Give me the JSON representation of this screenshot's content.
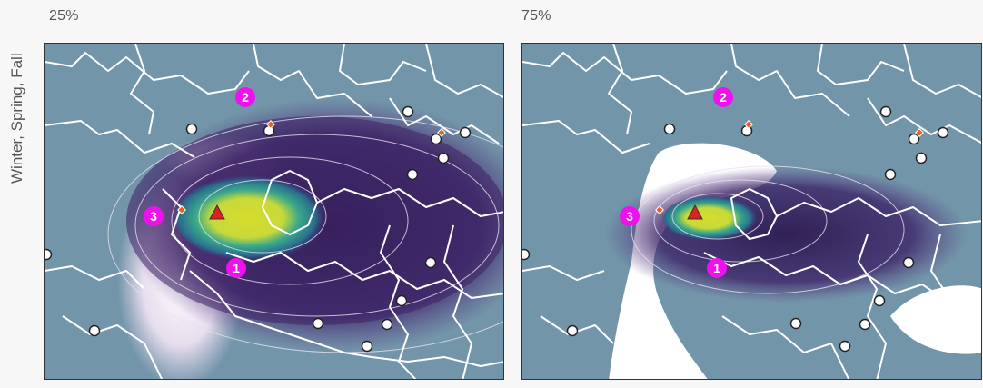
{
  "panels": [
    {
      "title": "25%"
    },
    {
      "title": "75%"
    }
  ],
  "row_label": "Winter, Spring, Fall",
  "markers": {
    "one": "1",
    "two": "2",
    "three": "3"
  },
  "colors": {
    "sea": "#7295a9",
    "border": "#ffffff",
    "plume_dark": "#3e2165",
    "plume_peak": "#d6dc2c",
    "marker": "#ee11ee",
    "source": "#e02020",
    "receptor": "#e8621a"
  },
  "icons": {
    "source": "red-triangle-icon",
    "receptor": "orange-diamond-icon",
    "station": "white-circle-icon"
  }
}
